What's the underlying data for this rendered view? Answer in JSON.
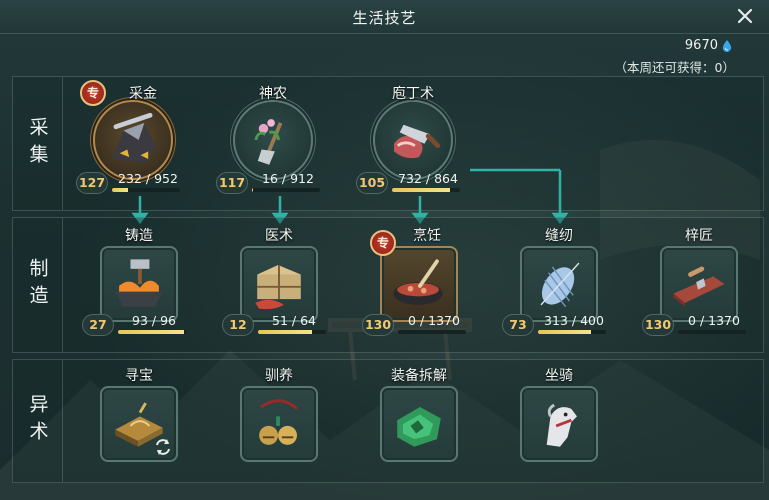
{
  "window": {
    "title": "生活技艺"
  },
  "currency": {
    "amount": "9670",
    "icon": "water-drop-icon"
  },
  "weekly_note": "（本周还可获得：0）",
  "colors": {
    "accent": "#2fb3a6",
    "progress": "#e6c655",
    "level": "#f1c871",
    "special_badge": "#c23a2d"
  },
  "rows": [
    {
      "label": "采集",
      "skills": [
        {
          "name": "采金",
          "level": "127",
          "progress": "232 / 952",
          "progress_fraction": 0.24,
          "special": true,
          "badge": "专",
          "icon": "gold-ore-icon"
        },
        {
          "name": "神农",
          "level": "117",
          "progress": "16 / 912",
          "progress_fraction": 0.02,
          "special": false,
          "icon": "herb-shovel-icon"
        },
        {
          "name": "庖丁术",
          "level": "105",
          "progress": "732 / 864",
          "progress_fraction": 0.85,
          "special": false,
          "icon": "meat-cleaver-icon"
        }
      ]
    },
    {
      "label": "制造",
      "skills": [
        {
          "name": "铸造",
          "level": "27",
          "progress": "93 / 96",
          "progress_fraction": 0.97,
          "special": false,
          "icon": "forge-hammer-icon"
        },
        {
          "name": "医术",
          "level": "12",
          "progress": "51 / 64",
          "progress_fraction": 0.8,
          "special": false,
          "icon": "medicine-pack-icon"
        },
        {
          "name": "烹饪",
          "level": "130",
          "progress": "0 / 1370",
          "progress_fraction": 0.0,
          "special": true,
          "badge": "专",
          "icon": "cooking-wok-icon"
        },
        {
          "name": "缝纫",
          "level": "73",
          "progress": "313 / 400",
          "progress_fraction": 0.78,
          "special": false,
          "icon": "thread-spool-icon"
        },
        {
          "name": "梓匠",
          "level": "130",
          "progress": "0 / 1370",
          "progress_fraction": 0.0,
          "special": false,
          "icon": "carpentry-plane-icon"
        }
      ]
    },
    {
      "label": "异术",
      "skills": [
        {
          "name": "寻宝",
          "icon": "treasure-map-icon",
          "refresh_icon": "refresh-icon"
        },
        {
          "name": "驯养",
          "icon": "bells-icon"
        },
        {
          "name": "装备拆解",
          "icon": "jade-shards-icon"
        },
        {
          "name": "坐骑",
          "icon": "horse-head-icon"
        }
      ]
    }
  ]
}
